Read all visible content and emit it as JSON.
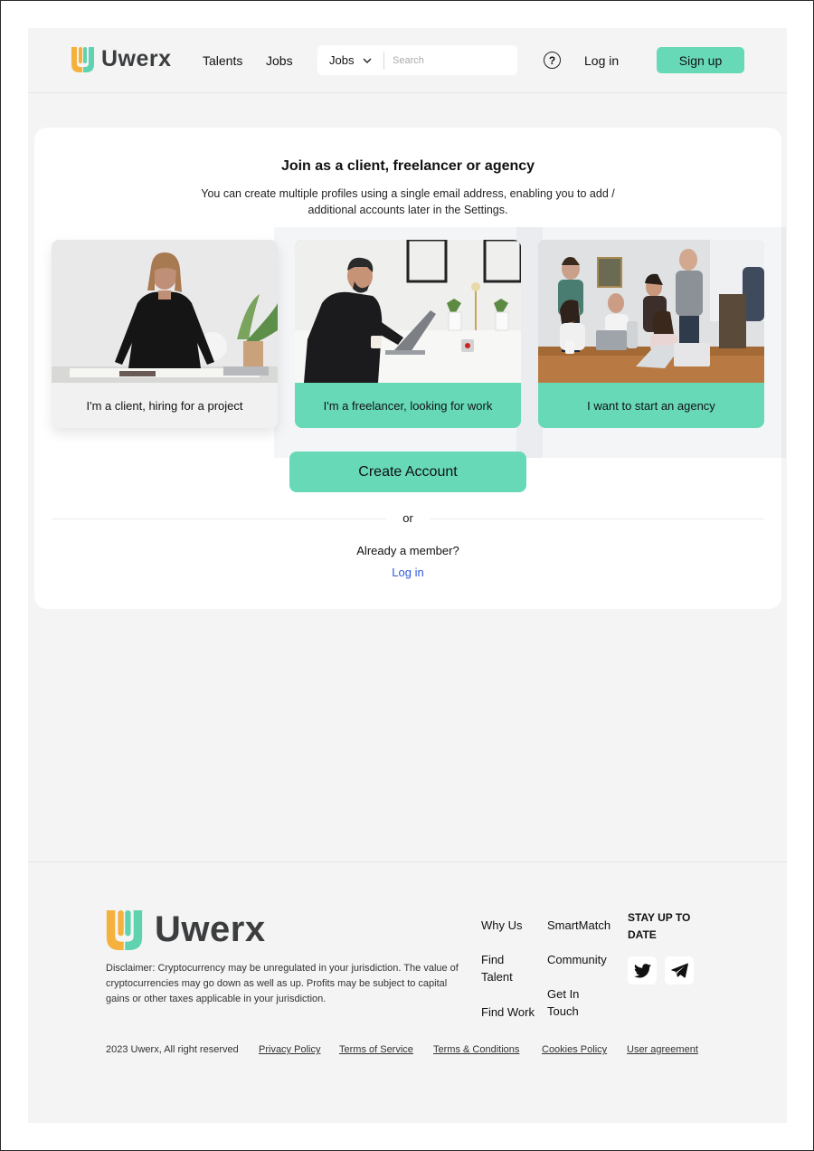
{
  "header": {
    "logo_text": "Uwerx",
    "nav": [
      "Talents",
      "Jobs"
    ],
    "search": {
      "category": "Jobs",
      "placeholder": "Search"
    },
    "help_symbol": "?",
    "login_label": "Log in",
    "signup_label": "Sign up"
  },
  "signup_card": {
    "title": "Join as a client, freelancer or agency",
    "subtitle": "You can create multiple profiles using a single email address, enabling you to add / additional accounts later in the Settings.",
    "options": [
      {
        "label": "I'm a client, hiring for a project",
        "selected": false
      },
      {
        "label": "I'm a freelancer, looking for work",
        "selected": true
      },
      {
        "label": "I want to start an agency",
        "selected": true
      }
    ],
    "create_button": "Create Account",
    "or_text": "or",
    "member_text": "Already a member?",
    "login_link": "Log in"
  },
  "footer": {
    "logo_text": "Uwerx",
    "disclaimer": "Disclaimer: Cryptocurrency may be unregulated in your jurisdiction. The value of cryptocurrencies may go down as well as up. Profits may be subject to capital gains or other taxes applicable in your jurisdiction.",
    "nav_col1": [
      "Why Us",
      "Find Talent",
      "Find Work"
    ],
    "nav_col2": [
      "SmartMatch",
      "Community",
      "Get In Touch"
    ],
    "stay_title": "STAY UP TO DATE",
    "socials": [
      "twitter-icon",
      "telegram-icon"
    ],
    "copyright": "2023 Uwerx, All right reserved",
    "links": [
      "Privacy Policy",
      "Terms of Service",
      "Terms & Conditions",
      "Cookies Policy",
      "User agreement"
    ]
  },
  "colors": {
    "accent": "#67d9b7",
    "logo_orange": "#f4b13d",
    "logo_green": "#5fd3b0",
    "link_blue": "#2f5bd8",
    "page_bg": "#f3f4f3"
  }
}
